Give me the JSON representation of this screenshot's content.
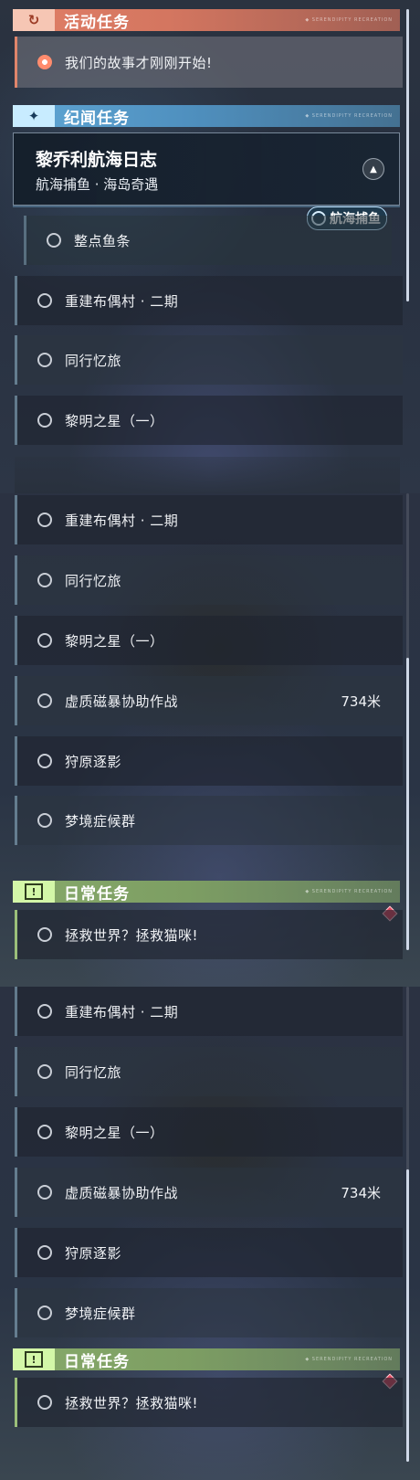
{
  "sections": {
    "event": {
      "title": "活动任务",
      "badge": "↻",
      "deco": "◆ SERENDIPITY RECREATION"
    },
    "saga": {
      "title": "纪闻任务",
      "badge": "✦",
      "deco": "◆ SERENDIPITY RECREATION"
    },
    "daily": {
      "title": "日常任务",
      "badge": "!",
      "deco": "◆ SERENDIPITY RECREATION"
    }
  },
  "event_quest": {
    "label": "我们的故事才刚刚开始!"
  },
  "saga_card": {
    "title": "黎乔利航海日志",
    "subtitle": "航海捕鱼 · 海岛奇遇",
    "tag": "航海捕鱼"
  },
  "saga_sub": {
    "label": "整点鱼条"
  },
  "quests": {
    "q1": "重建布偶村 · 二期",
    "q2": "同行忆旅",
    "q3": "黎明之星（一）",
    "q4": "虚质磁暴协助作战",
    "q4_dist": "734米",
    "q5": "狩原逐影",
    "q6": "梦境症候群"
  },
  "daily_quest": {
    "label": "拯救世界？拯救猫咪!"
  },
  "colors": {
    "event": "#e07e66",
    "saga": "#5fa6d4",
    "daily": "#86a96a",
    "marker": "#e0455c"
  }
}
